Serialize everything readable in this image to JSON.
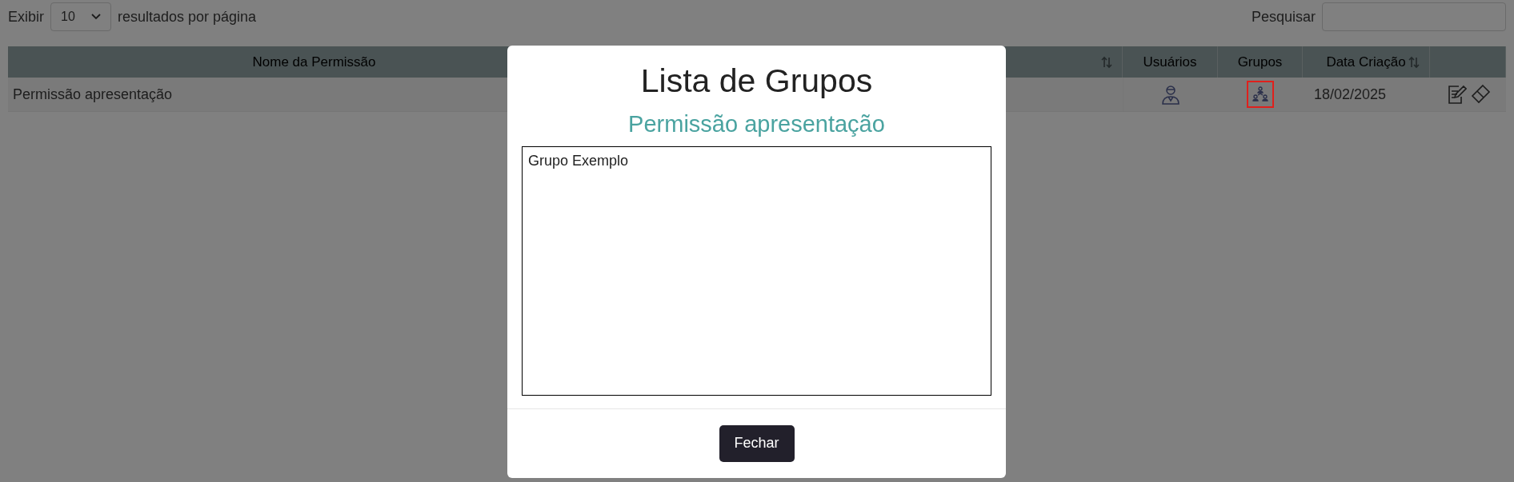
{
  "length_control": {
    "label_before": "Exibir",
    "value": "10",
    "label_after": "resultados por página"
  },
  "search": {
    "label": "Pesquisar"
  },
  "table": {
    "columns": [
      {
        "label": "Nome da Permissão"
      },
      {
        "sortable": true
      },
      {
        "label": "Usuários",
        "sortable": false
      },
      {
        "label": "Grupos",
        "sortable": false
      },
      {
        "label": "Data Criação",
        "sortable": true
      },
      {
        "sortable": false
      }
    ],
    "rows": [
      {
        "name": "Permissão apresentação",
        "groups_highlighted": true,
        "created": "18/02/2025"
      }
    ]
  },
  "modal": {
    "title": "Lista de Grupos",
    "subtitle": "Permissão apresentação",
    "items": [
      "Grupo Exemplo"
    ],
    "button": "Fechar"
  }
}
